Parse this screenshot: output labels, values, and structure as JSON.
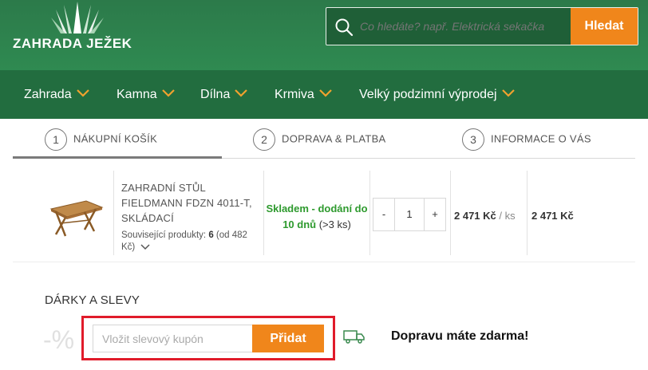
{
  "brand": {
    "name": "ZAHRADA JEŽEK"
  },
  "search": {
    "placeholder": "Co hledáte? např. Elektrická sekačka",
    "button_label": "Hledat"
  },
  "nav": {
    "items": [
      {
        "label": "Zahrada"
      },
      {
        "label": "Kamna"
      },
      {
        "label": "Dílna"
      },
      {
        "label": "Krmiva"
      },
      {
        "label": "Velký podzimní výprodej"
      }
    ]
  },
  "steps": [
    {
      "number": "1",
      "label": "NÁKUPNÍ KOŠÍK",
      "active": true
    },
    {
      "number": "2",
      "label": "DOPRAVA & PLATBA",
      "active": false
    },
    {
      "number": "3",
      "label": "INFORMACE O VÁS",
      "active": false
    }
  ],
  "cart_item": {
    "name": "ZAHRADNÍ STŮL FIELDMANN FDZN 4011-T, SKLÁDACÍ",
    "related_prefix": "Související produkty: ",
    "related_count": "6",
    "related_suffix": " (od 482 Kč)",
    "stock_status": "Skladem - dodání do 10 dnů",
    "stock_qty": "(>3 ks)",
    "quantity": "1",
    "minus_label": "-",
    "plus_label": "+",
    "unit_price": "2 471 Kč",
    "unit_suffix": " / ks",
    "total_price": "2 471 Kč"
  },
  "discounts": {
    "title": "DÁRKY A SLEVY",
    "percent_symbol": "-%",
    "coupon_placeholder": "Vložit slevový kupón",
    "add_button": "Přidat",
    "free_shipping": "Dopravu máte zdarma!"
  },
  "colors": {
    "header_green": "#2c7a4a",
    "nav_green": "#226d3f",
    "accent_orange": "#f0861b",
    "stock_green": "#2e9a2e",
    "highlight_red": "#e01b2a"
  }
}
